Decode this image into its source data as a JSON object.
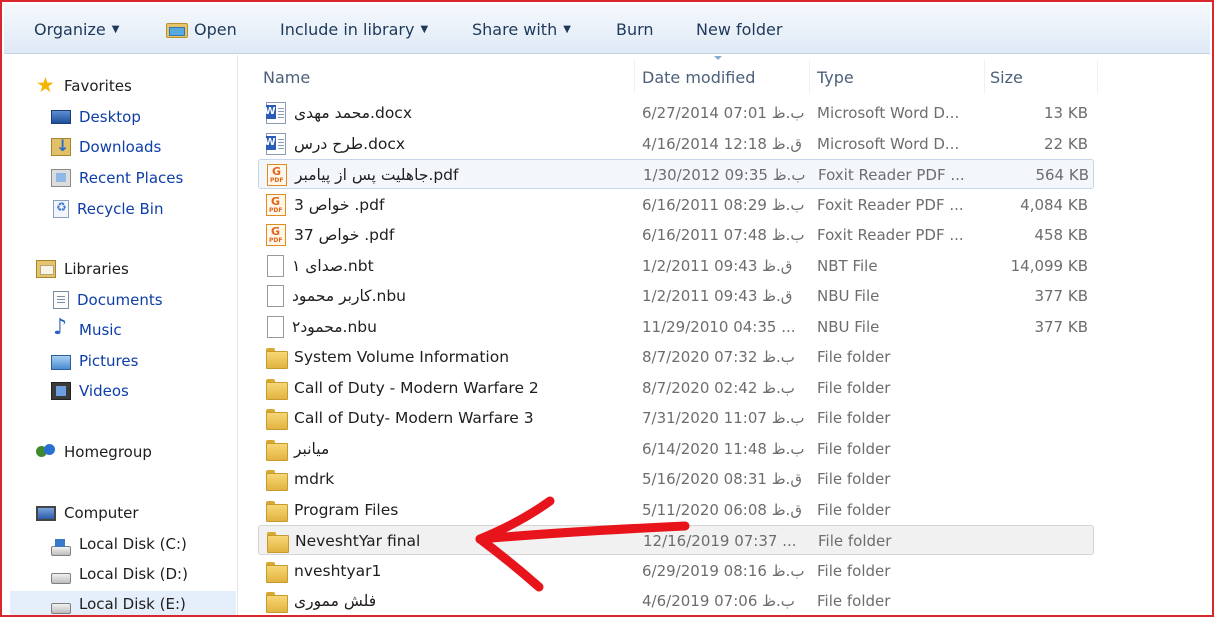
{
  "toolbar": {
    "organize": "Organize",
    "open": "Open",
    "include_in_library": "Include in library",
    "share_with": "Share with",
    "burn": "Burn",
    "new_folder": "New folder"
  },
  "nav": {
    "favorites": "Favorites",
    "desktop": "Desktop",
    "downloads": "Downloads",
    "recent_places": "Recent Places",
    "recycle_bin": "Recycle Bin",
    "libraries": "Libraries",
    "documents": "Documents",
    "music": "Music",
    "pictures": "Pictures",
    "videos": "Videos",
    "homegroup": "Homegroup",
    "computer": "Computer",
    "disk_c": "Local Disk (C:)",
    "disk_d": "Local Disk (D:)",
    "disk_e": "Local Disk (E:)"
  },
  "columns": {
    "name": "Name",
    "date_modified": "Date modified",
    "type": "Type",
    "size": "Size"
  },
  "files": [
    {
      "name": "محمد مهدی.docx",
      "date": "6/27/2014 07:01 ب.ظ",
      "type": "Microsoft Word D...",
      "size": "13 KB",
      "icon": "word-doc-icon"
    },
    {
      "name": "طرح درس.docx",
      "date": "4/16/2014 12:18 ق.ظ",
      "type": "Microsoft Word D...",
      "size": "22 KB",
      "icon": "word-doc-icon"
    },
    {
      "name": "جاهلیت پس از پیامبر.pdf",
      "date": "1/30/2012 09:35 ب.ظ",
      "type": "Foxit Reader PDF ...",
      "size": "564 KB",
      "icon": "pdf-icon"
    },
    {
      "name": "خواص 3 .pdf",
      "date": "6/16/2011 08:29 ب.ظ",
      "type": "Foxit Reader PDF ...",
      "size": "4,084 KB",
      "icon": "pdf-icon"
    },
    {
      "name": "خواص 37 .pdf",
      "date": "6/16/2011 07:48 ب.ظ",
      "type": "Foxit Reader PDF ...",
      "size": "458 KB",
      "icon": "pdf-icon"
    },
    {
      "name": "صدای ۱.nbt",
      "date": "1/2/2011 09:43 ق.ظ",
      "type": "NBT File",
      "size": "14,099 KB",
      "icon": "blank-file-icon"
    },
    {
      "name": "کاربر محمود.nbu",
      "date": "1/2/2011 09:43 ق.ظ",
      "type": "NBU File",
      "size": "377 KB",
      "icon": "blank-file-icon"
    },
    {
      "name": "محمود۲.nbu",
      "date": "11/29/2010 04:35 ...",
      "type": "NBU File",
      "size": "377 KB",
      "icon": "blank-file-icon"
    },
    {
      "name": "System Volume Information",
      "date": "8/7/2020 07:32 ب.ظ",
      "type": "File folder",
      "size": "",
      "icon": "folder-icon"
    },
    {
      "name": "Call of Duty - Modern Warfare 2",
      "date": "8/7/2020 02:42 ب.ظ",
      "type": "File folder",
      "size": "",
      "icon": "folder-icon"
    },
    {
      "name": "Call of Duty- Modern Warfare 3",
      "date": "7/31/2020 11:07 ب.ظ",
      "type": "File folder",
      "size": "",
      "icon": "folder-icon"
    },
    {
      "name": "میانبر",
      "date": "6/14/2020 11:48 ب.ظ",
      "type": "File folder",
      "size": "",
      "icon": "folder-icon"
    },
    {
      "name": "mdrk",
      "date": "5/16/2020 08:31 ق.ظ",
      "type": "File folder",
      "size": "",
      "icon": "folder-icon"
    },
    {
      "name": "Program Files",
      "date": "5/11/2020 06:08 ق.ظ",
      "type": "File folder",
      "size": "",
      "icon": "folder-icon"
    },
    {
      "name": "NeveshtYar final",
      "date": "12/16/2019 07:37 ...",
      "type": "File folder",
      "size": "",
      "icon": "folder-icon"
    },
    {
      "name": "nveshtyar1",
      "date": "6/29/2019 08:16 ب.ظ",
      "type": "File folder",
      "size": "",
      "icon": "folder-icon"
    },
    {
      "name": "فلش مموری",
      "date": "4/6/2019 07:06 ب.ظ",
      "type": "File folder",
      "size": "",
      "icon": "folder-icon"
    }
  ],
  "colors": {
    "frame_border": "#d9272e",
    "annotation_arrow": "#e8141b",
    "nav_link": "#0d3ea8",
    "toolbar_text": "#1e395b"
  }
}
